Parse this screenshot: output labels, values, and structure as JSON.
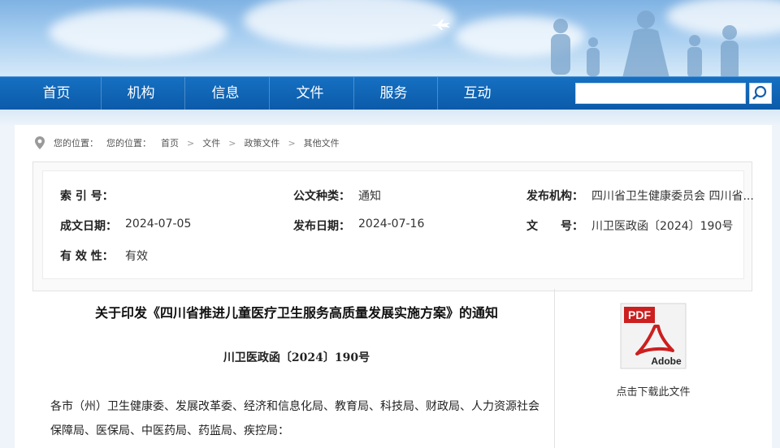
{
  "nav": {
    "items": [
      "首页",
      "机构",
      "信息",
      "文件",
      "服务",
      "互动"
    ],
    "search_placeholder": ""
  },
  "breadcrumb": {
    "prefix": "您的位置：",
    "prefix2": "您的位置：",
    "items": [
      "首页",
      "文件",
      "政策文件",
      "其他文件"
    ],
    "separator": ">"
  },
  "meta": {
    "index_label": "索 引 号：",
    "index_value": "",
    "doc_type_label": "公文种类：",
    "doc_type_value": "通知",
    "issuer_label": "发布机构：",
    "issuer_value": "四川省卫生健康委员会 四川省...",
    "written_date_label": "成文日期：",
    "written_date_value": "2024-07-05",
    "publish_date_label": "发布日期：",
    "publish_date_value": "2024-07-16",
    "doc_no_label": "文　　号：",
    "doc_no_value": "川卫医政函〔2024〕190号",
    "validity_label": "有 效 性：",
    "validity_value": "有效"
  },
  "document": {
    "title": "关于印发《四川省推进儿童医疗卫生服务高质量发展实施方案》的通知",
    "number": "川卫医政函〔2024〕190号",
    "paragraph": "各市（州）卫生健康委、发展改革委、经济和信息化局、教育局、科技局、财政局、人力资源社会保障局、医保局、中医药局、药监局、疾控局："
  },
  "download": {
    "label": "点击下载此文件",
    "icon": "pdf-adobe-icon",
    "pdf_text": "PDF",
    "adobe_text": "Adobe"
  },
  "colors": {
    "nav_bg": "#0b5aa8",
    "pdf_red": "#cc1f1f"
  }
}
